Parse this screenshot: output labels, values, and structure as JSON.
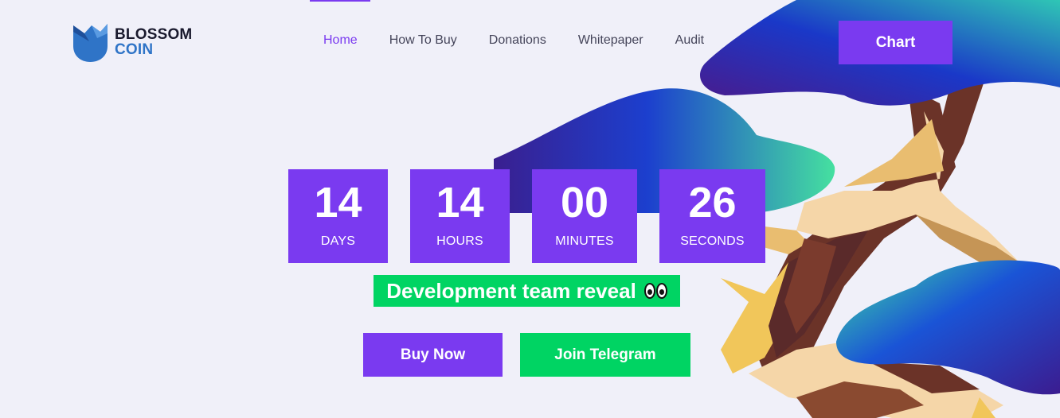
{
  "brand": {
    "name_line1": "BLOSSOM",
    "name_line2": "COIN"
  },
  "nav": {
    "items": [
      {
        "label": "Home",
        "active": true
      },
      {
        "label": "How To Buy",
        "active": false
      },
      {
        "label": "Donations",
        "active": false
      },
      {
        "label": "Whitepaper",
        "active": false
      },
      {
        "label": "Audit",
        "active": false
      }
    ],
    "cta_label": "Chart"
  },
  "countdown": {
    "days": {
      "value": "14",
      "label": "DAYS"
    },
    "hours": {
      "value": "14",
      "label": "HOURS"
    },
    "minutes": {
      "value": "00",
      "label": "MINUTES"
    },
    "seconds": {
      "value": "26",
      "label": "SECONDS"
    }
  },
  "banner": {
    "text": "Development team reveal",
    "emoji_icon": "eyes-icon"
  },
  "actions": {
    "buy_label": "Buy Now",
    "telegram_label": "Join Telegram"
  },
  "colors": {
    "primary": "#7a3af0",
    "accent_green": "#00d463",
    "background": "#f0f0f9"
  }
}
